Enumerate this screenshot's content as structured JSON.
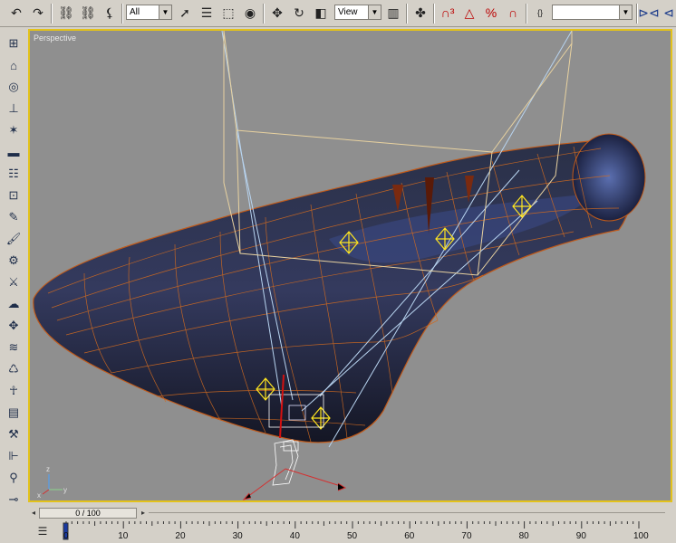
{
  "toolbar": {
    "selection_filter": "All",
    "coord_system": "View",
    "named_selection": "",
    "icons": [
      "undo-icon",
      "redo-icon",
      "select-link-icon",
      "unlink-icon",
      "bind-spacewarp-icon",
      "select-object-icon",
      "select-by-name-icon",
      "rect-selection-icon",
      "window-crossing-icon",
      "move-icon",
      "rotate-icon",
      "scale-icon",
      "pivot-icon",
      "select-manipulate-icon",
      "snap-3-icon",
      "angle-snap-icon",
      "percent-snap-icon",
      "spinner-snap-icon",
      "edit-named-selection-icon",
      "mirror-icon",
      "align-icon"
    ]
  },
  "left_toolbar": {
    "icons": [
      "create-icon",
      "modify-icon",
      "hierarchy-icon",
      "motion-icon",
      "display-icon",
      "utilities-icon",
      "box-icon",
      "sphere-icon",
      "pencil-icon",
      "paint-icon",
      "gear-icon",
      "bone-icon",
      "light-icon",
      "camera-icon",
      "helpers-icon",
      "spacewarp-icon",
      "wave-icon",
      "link-icon",
      "figure-icon",
      "cylinder-icon",
      "wrench-icon",
      "bar-icon",
      "clamp-icon",
      "chain-icon",
      "render-icon"
    ]
  },
  "viewport": {
    "label": "Perspective",
    "active_border_color": "#e3c21a",
    "background_color": "#8f8f8f"
  },
  "time_slider": {
    "value": "0 / 100"
  },
  "ruler": {
    "ticks": [
      "0",
      "10",
      "20",
      "30",
      "40",
      "50",
      "60",
      "70",
      "80",
      "90",
      "100"
    ]
  }
}
